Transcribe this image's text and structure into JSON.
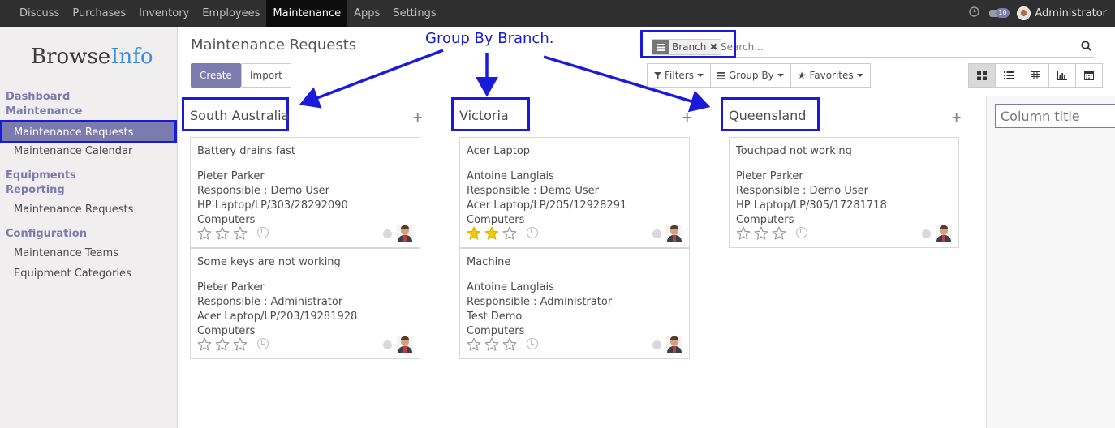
{
  "topbar": {
    "menu": [
      "Discuss",
      "Purchases",
      "Inventory",
      "Employees",
      "Maintenance",
      "Apps",
      "Settings"
    ],
    "active_menu": "Maintenance",
    "chat_count": "10",
    "user": "Administrator"
  },
  "sidebar": {
    "logo_browse": "Browse",
    "logo_info": "Info",
    "dashboard": "Dashboard",
    "maintenance_head": "Maintenance",
    "maintenance_requests": "Maintenance Requests",
    "maintenance_calendar": "Maintenance Calendar",
    "equipments_head": "Equipments",
    "reporting_head": "Reporting",
    "reporting_requests": "Maintenance Requests",
    "configuration_head": "Configuration",
    "maintenance_teams": "Maintenance Teams",
    "equipment_categories": "Equipment Categories"
  },
  "control_panel": {
    "title": "Maintenance Requests",
    "create": "Create",
    "import": "Import",
    "facet_label": "Branch",
    "search_placeholder": "Search...",
    "filters": "Filters",
    "group_by": "Group By",
    "favorites": "Favorites"
  },
  "annotation": {
    "text": "Group By Branch."
  },
  "columns": [
    {
      "title": "South Australia",
      "cards": [
        {
          "name": "Battery drains fast",
          "owner": "Pieter Parker",
          "responsible": "Responsible : Demo User",
          "equipment": "HP Laptop/LP/303/28292090",
          "category": "Computers",
          "stars": 0
        },
        {
          "name": "Some keys are not working",
          "owner": "Pieter Parker",
          "responsible": "Responsible : Administrator",
          "equipment": "Acer Laptop/LP/203/19281928",
          "category": "Computers",
          "stars": 0
        }
      ]
    },
    {
      "title": "Victoria",
      "cards": [
        {
          "name": "Acer Laptop",
          "owner": "Antoine Langlais",
          "responsible": "Responsible : Demo User",
          "equipment": "Acer Laptop/LP/205/12928291",
          "category": "Computers",
          "stars": 2
        },
        {
          "name": "Machine",
          "owner": "Antoine Langlais",
          "responsible": "Responsible : Administrator",
          "equipment": "Test Demo",
          "category": "Computers",
          "stars": 0
        }
      ]
    },
    {
      "title": "Queensland",
      "cards": [
        {
          "name": "Touchpad not working",
          "owner": "Pieter Parker",
          "responsible": "Responsible : Demo User",
          "equipment": "HP Laptop/LP/305/17281718",
          "category": "Computers",
          "stars": 0
        }
      ]
    }
  ],
  "new_column_placeholder": "Column title",
  "colors": {
    "accent": "#7c7bad",
    "annotation": "#1a1adb",
    "star_filled": "#f3cc00"
  }
}
